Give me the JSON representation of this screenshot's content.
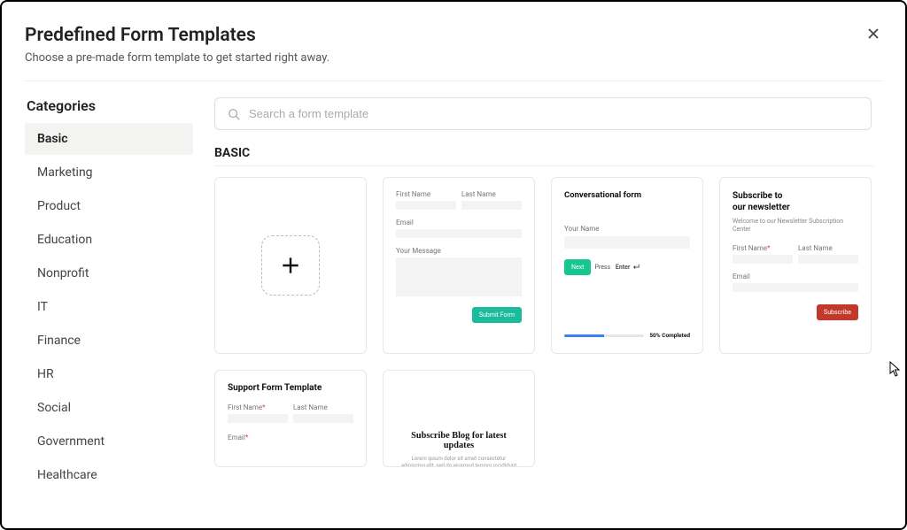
{
  "header": {
    "title": "Predefined Form Templates",
    "subtitle": "Choose a pre-made form template to get started right away."
  },
  "sidebar": {
    "heading": "Categories",
    "items": [
      {
        "label": "Basic",
        "active": true
      },
      {
        "label": "Marketing",
        "active": false
      },
      {
        "label": "Product",
        "active": false
      },
      {
        "label": "Education",
        "active": false
      },
      {
        "label": "Nonprofit",
        "active": false
      },
      {
        "label": "IT",
        "active": false
      },
      {
        "label": "Finance",
        "active": false
      },
      {
        "label": "HR",
        "active": false
      },
      {
        "label": "Social",
        "active": false
      },
      {
        "label": "Government",
        "active": false
      },
      {
        "label": "Healthcare",
        "active": false
      }
    ]
  },
  "search": {
    "placeholder": "Search a form template"
  },
  "section_heading": "BASIC",
  "cards": {
    "contact": {
      "first_name": "First Name",
      "last_name": "Last Name",
      "email": "Email",
      "message": "Your Message",
      "submit": "Submit Form"
    },
    "conversational": {
      "title": "Conversational form",
      "your_name": "Your Name",
      "next": "Next",
      "press": "Press",
      "enter": "Enter",
      "progress": "50% Completed"
    },
    "newsletter": {
      "title_l1": "Subscribe to",
      "title_l2": "our newsletter",
      "welcome": "Welcome to our Newsletter Subscription Center",
      "first_name": "First Name",
      "last_name": "Last Name",
      "email": "Email",
      "subscribe": "Subscribe"
    },
    "support": {
      "title": "Support Form Template",
      "first_name": "First Name",
      "last_name": "Last Name",
      "email": "Email"
    },
    "blog": {
      "title": "Subscribe Blog for latest updates",
      "lorem": "Lorem ipsum dolor sit amet consectetur adipiscing elit, sed do eiusmod tempor incididunt ut labore et dolore magna"
    }
  }
}
